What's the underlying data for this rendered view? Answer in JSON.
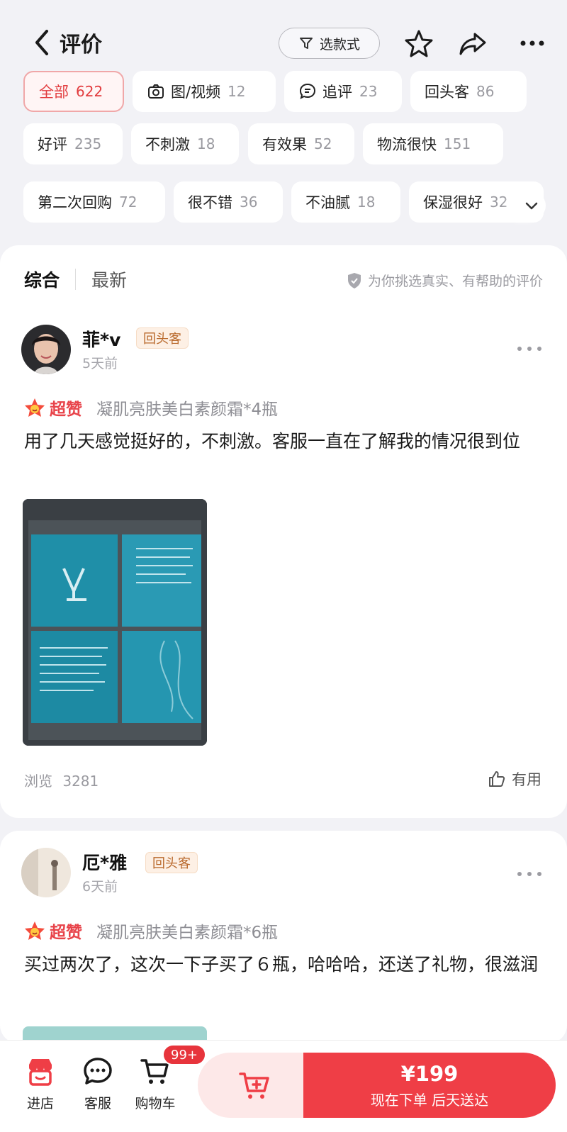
{
  "header": {
    "title": "评价",
    "filter_label": "选款式"
  },
  "tags": [
    {
      "label": "全部",
      "count": "622",
      "active": true
    },
    {
      "label": "图/视频",
      "count": "12",
      "icon": "camera-icon"
    },
    {
      "label": "追评",
      "count": "23",
      "icon": "comment-icon"
    },
    {
      "label": "回头客",
      "count": "86"
    },
    {
      "label": "好评",
      "count": "235"
    },
    {
      "label": "不刺激",
      "count": "18"
    },
    {
      "label": "有效果",
      "count": "52"
    },
    {
      "label": "物流很快",
      "count": "151"
    },
    {
      "label": "第二次回购",
      "count": "72"
    },
    {
      "label": "很不错",
      "count": "36"
    },
    {
      "label": "不油腻",
      "count": "18"
    },
    {
      "label": "保湿很好",
      "count": "32"
    }
  ],
  "sort": {
    "options": [
      "综合",
      "最新"
    ],
    "note": "为你挑选真实、有帮助的评价"
  },
  "reviews": [
    {
      "user": "菲*v",
      "badge": "回头客",
      "time": "5天前",
      "rating_label": "超赞",
      "sku": "凝肌亮肤美白素颜霜*4瓶",
      "content": "用了几天感觉挺好的，不刺激。客服一直在了解我的情况很到位",
      "views_label": "浏览",
      "views": "3281",
      "useful_label": "有用"
    },
    {
      "user": "厄*雅",
      "badge": "回头客",
      "time": "6天前",
      "rating_label": "超赞",
      "sku": "凝肌亮肤美白素颜霜*6瓶",
      "content": "买过两次了，这次一下子买了６瓶，哈哈哈，还送了礼物，很滋润"
    }
  ],
  "bottom": {
    "store": "进店",
    "service": "客服",
    "cart": "购物车",
    "cart_badge": "99+",
    "price": "¥199",
    "buy_label": "现在下单 后天送达"
  },
  "colors": {
    "accent": "#ef3e46",
    "badge_bg": "#fdf0e5",
    "badge_text": "#b9692c"
  }
}
